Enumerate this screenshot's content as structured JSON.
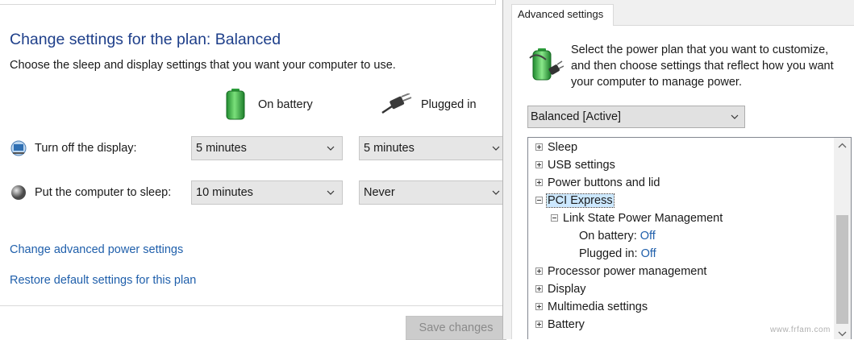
{
  "plan": {
    "title": "Change settings for the plan: Balanced",
    "subtitle": "Choose the sleep and display settings that you want your computer to use.",
    "columns": {
      "on_battery": "On battery",
      "plugged_in": "Plugged in"
    },
    "rows": [
      {
        "label": "Turn off the display:",
        "battery": "5 minutes",
        "plugged": "5 minutes"
      },
      {
        "label": "Put the computer to sleep:",
        "battery": "10 minutes",
        "plugged": "Never"
      }
    ],
    "links": {
      "advanced": "Change advanced power settings",
      "restore": "Restore default settings for this plan"
    },
    "save_label": "Save changes"
  },
  "dialog": {
    "tab": "Advanced settings",
    "intro": "Select the power plan that you want to customize, and then choose settings that reflect how you want your computer to manage power.",
    "plan_select": "Balanced [Active]",
    "tree": [
      {
        "label": "Sleep"
      },
      {
        "label": "USB settings"
      },
      {
        "label": "Power buttons and lid"
      },
      {
        "label": "PCI Express"
      },
      {
        "label": "Link State Power Management"
      },
      {
        "label": "On battery:",
        "value": "Off"
      },
      {
        "label": "Plugged in:",
        "value": "Off"
      },
      {
        "label": "Processor power management"
      },
      {
        "label": "Display"
      },
      {
        "label": "Multimedia settings"
      },
      {
        "label": "Battery"
      }
    ]
  },
  "watermark": "www.frfam.com",
  "icons": {
    "battery": "battery-icon",
    "plug": "plug-icon",
    "display": "monitor-icon",
    "sleep": "moon-icon",
    "plan": "power-plan-icon"
  },
  "colors": {
    "title": "#1e3f8a",
    "link": "#1f5fab",
    "selection": "#cce8ff"
  }
}
